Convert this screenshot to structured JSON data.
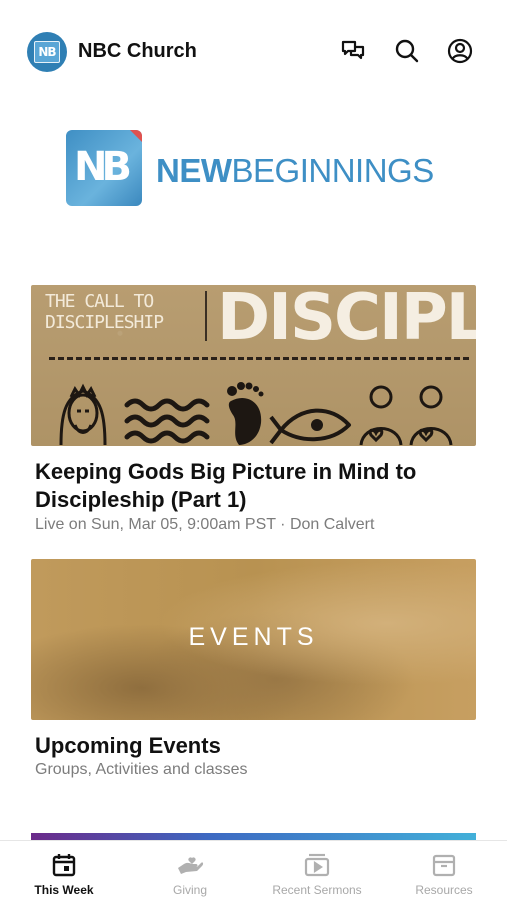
{
  "header": {
    "app_title": "NBC Church",
    "avatar_text": "NB",
    "icons": [
      "chat-icon",
      "search-icon",
      "profile-icon"
    ]
  },
  "logo": {
    "mark_text": "NB",
    "text_bold": "NEW",
    "text_light": "BEGINNINGS"
  },
  "sermon_card": {
    "artwork_small_title": [
      "THE CALL TO",
      "DISCIPLESHIP"
    ],
    "artwork_big_title": "DISCIPLE",
    "title": "Keeping Gods Big Picture in Mind to Discipleship (Part 1)",
    "title_lines": [
      "Keeping Gods Big Picture in Mind to",
      "Discipleship (Part 1)"
    ],
    "subtitle": "Live on Sun, Mar 05, 9:00am PST · Don Calvert"
  },
  "events_card": {
    "artwork_label": "EVENTS",
    "title": "Upcoming Events",
    "subtitle": "Groups, Activities and classes"
  },
  "tabbar": {
    "tabs": [
      {
        "label": "This Week",
        "icon": "calendar-icon",
        "active": true
      },
      {
        "label": "Giving",
        "icon": "giving-hand-icon",
        "active": false
      },
      {
        "label": "Recent Sermons",
        "icon": "video-play-icon",
        "active": false
      },
      {
        "label": "Resources",
        "icon": "archive-box-icon",
        "active": false
      }
    ]
  },
  "colors": {
    "brand_blue": "#3e8fc5",
    "active_tab": "#111111",
    "inactive_tab": "#a8a8a8"
  }
}
